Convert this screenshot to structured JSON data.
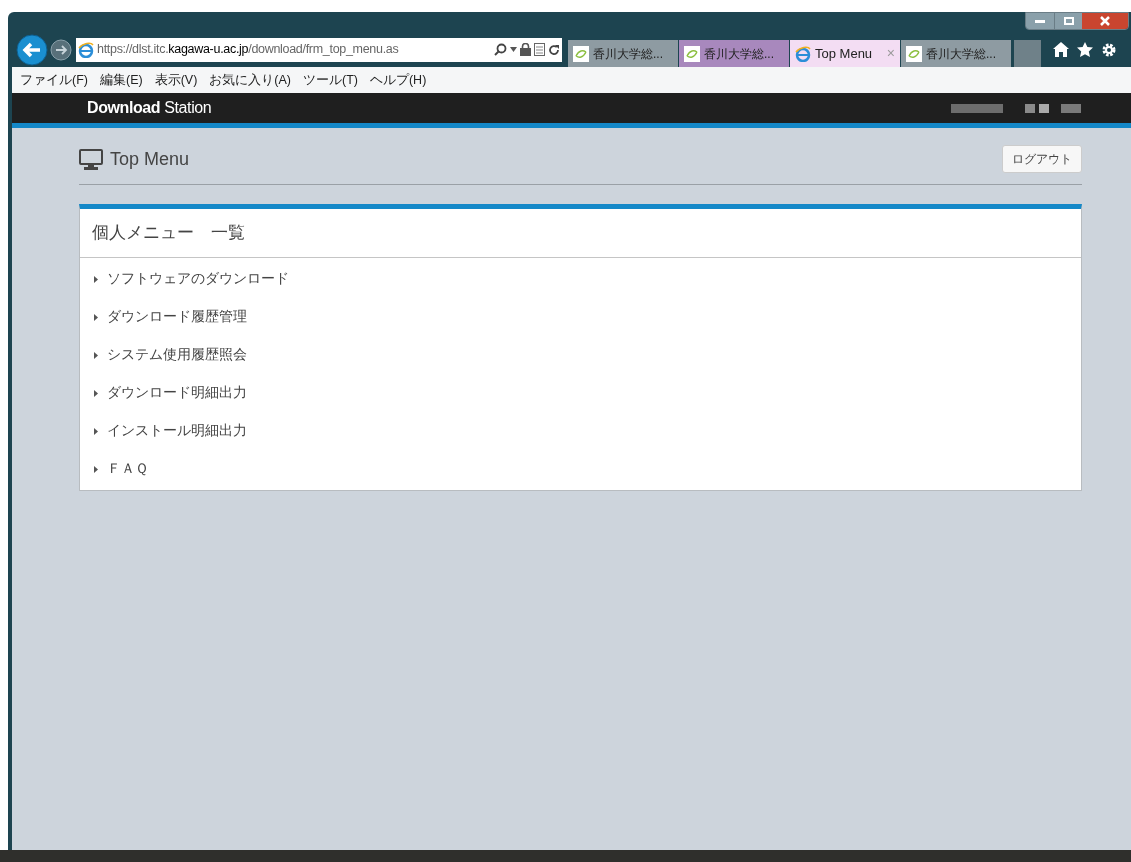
{
  "browser": {
    "address": {
      "prefix": "https://dlst.itc.",
      "domain": "kagawa-u.ac.jp",
      "path": "/download/frm_top_menu.as"
    },
    "tabs": [
      {
        "label": "香川大学総...",
        "selected": false,
        "kind": "site",
        "color": "#8e9ba2"
      },
      {
        "label": "香川大学総...",
        "selected": false,
        "kind": "site",
        "color": "#a888bd"
      },
      {
        "label": "Top Menu",
        "selected": true,
        "kind": "browser",
        "color": "#f3ddf3",
        "close": "×"
      },
      {
        "label": "香川大学総...",
        "selected": false,
        "kind": "site",
        "color": "#8e9ba2"
      }
    ],
    "menu": [
      "ファイル(F)",
      "編集(E)",
      "表示(V)",
      "お気に入り(A)",
      "ツール(T)",
      "ヘルプ(H)"
    ]
  },
  "app": {
    "brand_bold": "Download",
    "brand_rest": "Station"
  },
  "page": {
    "title": "Top Menu",
    "logout": "ログアウト",
    "panel": {
      "title": "個人メニュー　一覧",
      "items": [
        "ソフトウェアのダウンロード",
        "ダウンロード履歴管理",
        "システム使用履歴照会",
        "ダウンロード明細出力",
        "インストール明細出力",
        "ＦＡＱ"
      ]
    }
  }
}
